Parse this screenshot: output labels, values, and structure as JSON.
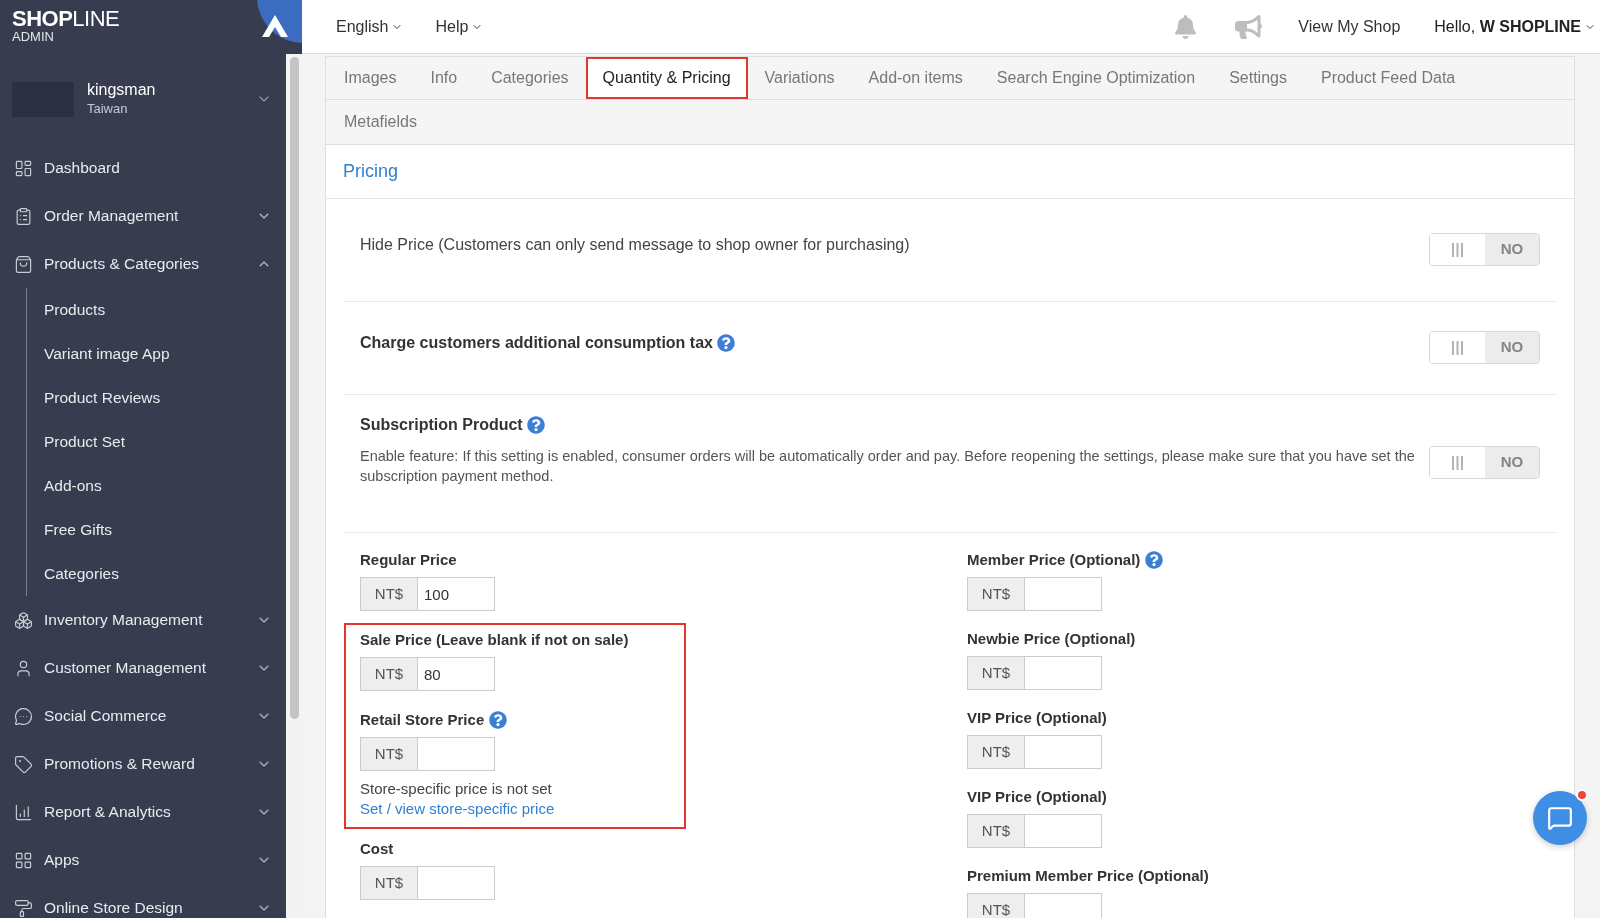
{
  "brand": {
    "logo_text": "**SHOP**LINE",
    "subtitle": "ADMIN"
  },
  "store": {
    "name": "kingsman",
    "region": "Taiwan"
  },
  "sidebar": {
    "items": [
      {
        "label": "Dashboard",
        "kind": "link"
      },
      {
        "label": "Order Management",
        "kind": "group",
        "expanded": false
      },
      {
        "label": "Products & Categories",
        "kind": "group",
        "expanded": true,
        "children": [
          {
            "label": "Products"
          },
          {
            "label": "Variant image App"
          },
          {
            "label": "Product Reviews"
          },
          {
            "label": "Product Set"
          },
          {
            "label": "Add-ons"
          },
          {
            "label": "Free Gifts"
          },
          {
            "label": "Categories"
          }
        ]
      },
      {
        "label": "Inventory Management",
        "kind": "group",
        "expanded": false
      },
      {
        "label": "Customer Management",
        "kind": "group",
        "expanded": false
      },
      {
        "label": "Social Commerce",
        "kind": "group",
        "expanded": false
      },
      {
        "label": "Promotions & Reward",
        "kind": "group",
        "expanded": false
      },
      {
        "label": "Report & Analytics",
        "kind": "group",
        "expanded": false
      },
      {
        "label": "Apps",
        "kind": "group",
        "expanded": false
      },
      {
        "label": "Online Store Design",
        "kind": "group",
        "expanded": false
      }
    ]
  },
  "top_bar": {
    "menus": [
      {
        "label": "English"
      },
      {
        "label": "Help"
      }
    ],
    "view_shop": "View My Shop",
    "greeting": "Hello, **W SHOPLINE**"
  },
  "tab_rows": [
    {
      "tabs": [
        {
          "label": "Images",
          "selected": false
        },
        {
          "label": "Info",
          "selected": false
        },
        {
          "label": "Categories",
          "selected": false
        },
        {
          "label": "Quantity & Pricing",
          "selected": true
        },
        {
          "label": "Variations",
          "selected": false
        },
        {
          "label": "Add-on items",
          "selected": false
        },
        {
          "label": "Search Engine Optimization",
          "selected": false
        },
        {
          "label": "Settings",
          "selected": false
        },
        {
          "label": "Product Feed Data",
          "selected": false
        }
      ]
    },
    {
      "tabs": [
        {
          "label": "Metafields",
          "selected": false
        }
      ]
    }
  ],
  "pricing": {
    "title": "Pricing",
    "settings": [
      {
        "kind": "plain",
        "label": "Hide Price (Customers can only send message to shop owner for purchasing)",
        "toggle": {
          "on": false,
          "label": "NO"
        }
      },
      {
        "kind": "help",
        "label": "Charge customers additional consumption tax",
        "toggle": {
          "on": false,
          "label": "NO"
        }
      },
      {
        "kind": "described",
        "label": "Subscription Product",
        "description": "Enable feature: If this setting is enabled, consumer orders will be automatically order and pay. Before reopening the settings, please make sure that you have set the subscription payment method.",
        "toggle": {
          "on": false,
          "label": "NO"
        }
      }
    ],
    "columns": [
      {
        "items": [
          {
            "kind": "field",
            "label": "Regular Price",
            "help": false,
            "prefix": "NT$",
            "value": "100"
          },
          {
            "kind": "highlight",
            "fields": [
              {
                "kind": "field",
                "label": "Sale Price (Leave blank if not on sale)",
                "help": false,
                "prefix": "NT$",
                "value": "80"
              },
              {
                "kind": "field",
                "label": "Retail Store Price",
                "help": true,
                "prefix": "NT$",
                "note": "Store-specific price is not set",
                "link": "Set / view store-specific price"
              }
            ]
          },
          {
            "kind": "field",
            "label": "Cost",
            "help": false,
            "prefix": "NT$"
          }
        ]
      },
      {
        "items": [
          {
            "kind": "field",
            "label": "Member Price (Optional)",
            "help": true,
            "prefix": "NT$"
          },
          {
            "kind": "field",
            "label": "Newbie Price (Optional)",
            "help": false,
            "prefix": "NT$"
          },
          {
            "kind": "field",
            "label": "VIP Price (Optional)",
            "help": false,
            "prefix": "NT$"
          },
          {
            "kind": "field",
            "label": "VIP Price (Optional)",
            "help": false,
            "prefix": "NT$"
          },
          {
            "kind": "field",
            "label": "Premium Member Price (Optional)",
            "help": false,
            "prefix": "NT$"
          }
        ]
      }
    ]
  },
  "chat": {
    "unread": true
  }
}
